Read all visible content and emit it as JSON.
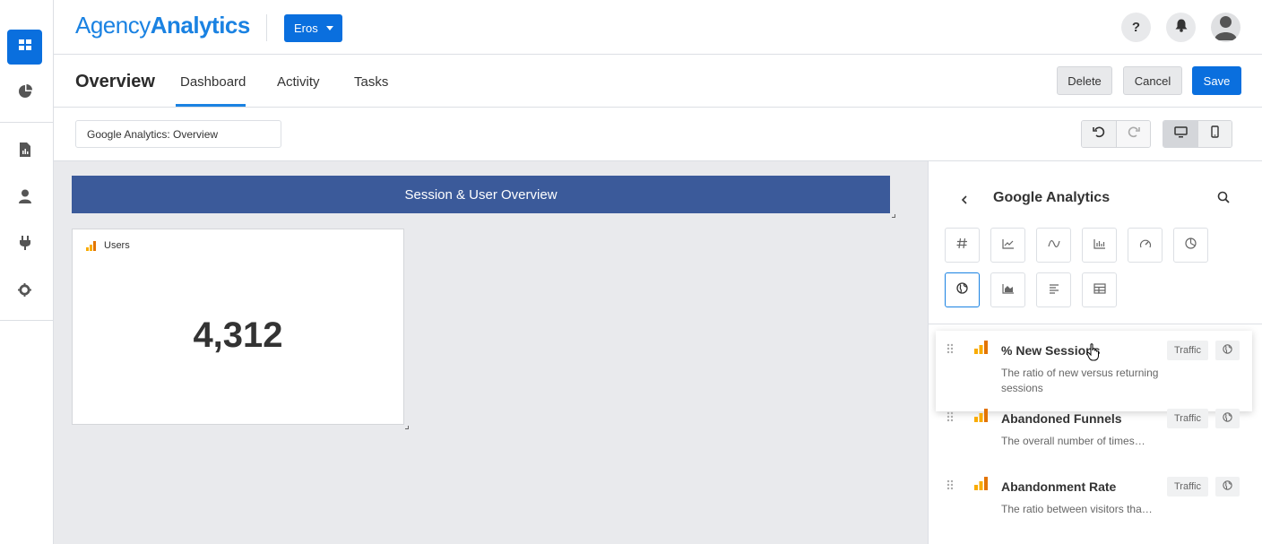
{
  "brand": {
    "name_part1": "Agency",
    "name_part2": "Analytics",
    "accent": "#1a82e2"
  },
  "client_selector": {
    "label": "Eros"
  },
  "header_icons": [
    "help-icon",
    "bell-icon",
    "user-avatar-icon"
  ],
  "help_label": "?",
  "rail": {
    "items": [
      "dashboard-icon",
      "pie-chart-icon",
      "report-icon",
      "user-icon",
      "plug-icon",
      "gear-icon"
    ]
  },
  "page": {
    "title": "Overview",
    "tabs": [
      {
        "label": "Dashboard",
        "active": true
      },
      {
        "label": "Activity"
      },
      {
        "label": "Tasks"
      }
    ]
  },
  "actions": {
    "delete": "Delete",
    "cancel": "Cancel",
    "save": "Save"
  },
  "toolbar": {
    "dashboard_name": "Google Analytics: Overview"
  },
  "canvas": {
    "section_title": "Session & User Overview",
    "widget": {
      "title": "Users",
      "value": "4,312"
    }
  },
  "panel": {
    "title": "Google Analytics",
    "widget_types": [
      "number-icon",
      "line-chart-icon",
      "sparkline-icon",
      "bar-chart-icon",
      "gauge-icon",
      "pie-chart-icon",
      "globe-icon",
      "area-chart-icon",
      "list-icon",
      "table-icon"
    ],
    "metrics": [
      {
        "name": "% New Sessions",
        "description": "The ratio of new versus returning sessions",
        "category": "Traffic"
      },
      {
        "name": "Abandoned Funnels",
        "description": "The overall number of times…",
        "category": "Traffic"
      },
      {
        "name": "Abandonment Rate",
        "description": "The ratio between visitors tha…",
        "category": "Traffic"
      }
    ]
  }
}
